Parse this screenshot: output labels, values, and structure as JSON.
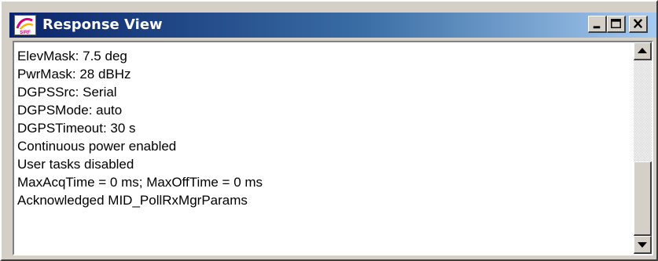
{
  "window": {
    "title": "Response View",
    "icon": "sirf-app-icon",
    "controls": [
      {
        "name": "minimize",
        "icon": "minimize-icon"
      },
      {
        "name": "maximize",
        "icon": "maximize-icon"
      },
      {
        "name": "close",
        "icon": "close-icon"
      }
    ]
  },
  "content": {
    "lines": [
      "ElevMask: 7.5 deg",
      "PwrMask: 28 dBHz",
      "DGPSSrc: Serial",
      "DGPSMode: auto",
      "DGPSTimeout: 30 s",
      "Continuous power enabled",
      "User tasks disabled",
      "MaxAcqTime = 0 ms; MaxOffTime = 0 ms",
      "Acknowledged MID_PollRxMgrParams"
    ]
  },
  "scrollbar": {
    "orientation": "vertical",
    "up_icon": "scroll-up-arrow-icon",
    "down_icon": "scroll-down-arrow-icon"
  },
  "colors": {
    "title_gradient_start": "#0a246a",
    "title_gradient_end": "#a6caf0",
    "face": "#d4d0c8",
    "text": "#000000",
    "background": "#ffffff"
  }
}
